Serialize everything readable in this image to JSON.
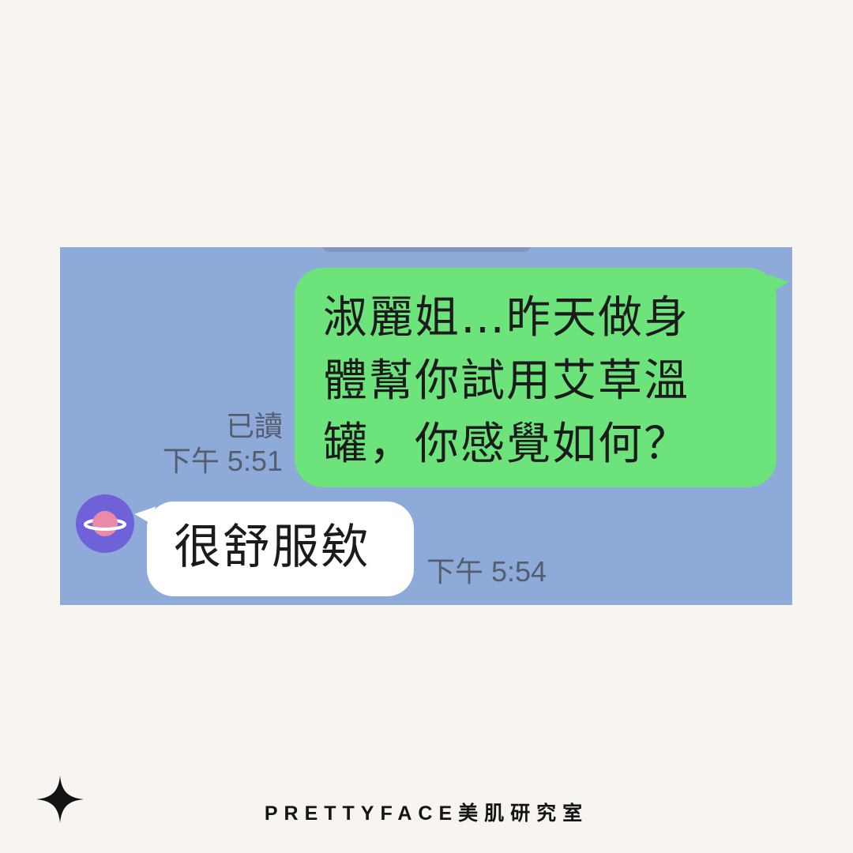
{
  "chat": {
    "outgoing": {
      "text": "淑麗姐…昨天做身\n體幫你試用艾草溫\n罐，你感覺如何？",
      "read_label": "已讀",
      "time": "下午 5:51"
    },
    "incoming": {
      "text": "很舒服欸",
      "time": "下午 5:54",
      "avatar_icon": "planet-icon"
    }
  },
  "footer": {
    "brand": "PRETTYFACE美肌研究室",
    "icon": "sparkle-icon"
  },
  "colors": {
    "page_bg": "#f8f5f0",
    "chat_bg": "#8eaad9",
    "outgoing_bubble": "#6de47b",
    "incoming_bubble": "#ffffff",
    "avatar_bg": "#6f62d9",
    "planet": "#e88aa8"
  }
}
